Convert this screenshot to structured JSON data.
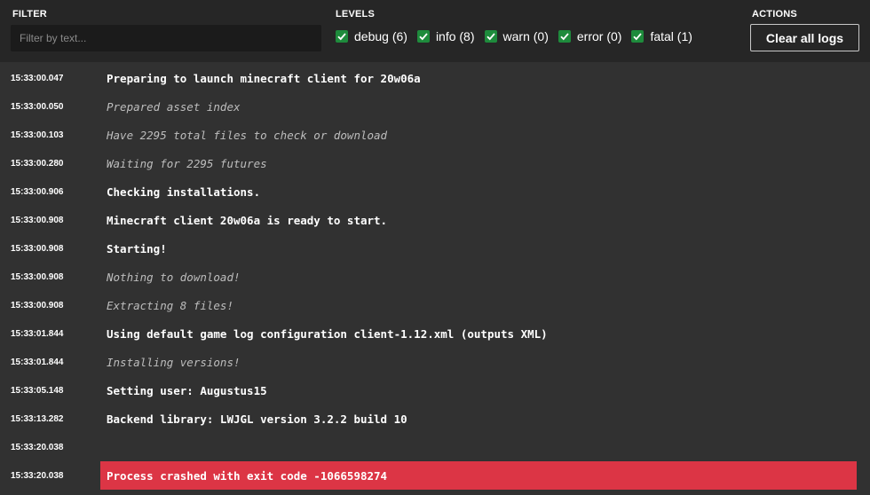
{
  "filter": {
    "title": "FILTER",
    "placeholder": "Filter by text..."
  },
  "levels": {
    "title": "LEVELS",
    "items": [
      {
        "label": "debug (6)",
        "checked": true
      },
      {
        "label": "info (8)",
        "checked": true
      },
      {
        "label": "warn (0)",
        "checked": true
      },
      {
        "label": "error (0)",
        "checked": true
      },
      {
        "label": "fatal (1)",
        "checked": true
      }
    ]
  },
  "actions": {
    "title": "ACTIONS",
    "clear_label": "Clear all logs"
  },
  "logs": [
    {
      "time": "15:33:00.047",
      "level": "info",
      "text": "Preparing to launch minecraft client for 20w06a"
    },
    {
      "time": "15:33:00.050",
      "level": "debug",
      "text": "Prepared asset index"
    },
    {
      "time": "15:33:00.103",
      "level": "debug",
      "text": "Have 2295 total files to check or download"
    },
    {
      "time": "15:33:00.280",
      "level": "debug",
      "text": "Waiting for 2295 futures"
    },
    {
      "time": "15:33:00.906",
      "level": "info",
      "text": "Checking installations."
    },
    {
      "time": "15:33:00.908",
      "level": "info",
      "text": "Minecraft client 20w06a is ready to start."
    },
    {
      "time": "15:33:00.908",
      "level": "info",
      "text": "Starting!"
    },
    {
      "time": "15:33:00.908",
      "level": "debug",
      "text": "Nothing to download!"
    },
    {
      "time": "15:33:00.908",
      "level": "debug",
      "text": "Extracting 8 files!"
    },
    {
      "time": "15:33:01.844",
      "level": "info",
      "text": "Using default game log configuration client-1.12.xml (outputs XML)"
    },
    {
      "time": "15:33:01.844",
      "level": "debug",
      "text": "Installing versions!"
    },
    {
      "time": "15:33:05.148",
      "level": "info",
      "text": "Setting user: Augustus15"
    },
    {
      "time": "15:33:13.282",
      "level": "info",
      "text": "Backend library: LWJGL version 3.2.2 build 10"
    },
    {
      "time": "15:33:20.038",
      "level": "info",
      "text": ""
    },
    {
      "time": "15:33:20.038",
      "level": "fatal",
      "text": "Process crashed with exit code -1066598274"
    }
  ],
  "colors": {
    "fatal_bg": "#dc3545",
    "check_bg": "#1e8b3c"
  }
}
